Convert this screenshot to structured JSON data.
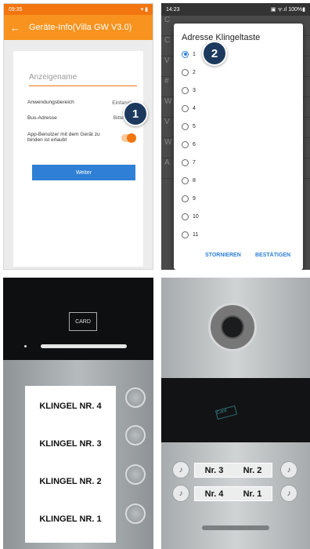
{
  "panel1": {
    "status_time": "09:35",
    "status_icons": "▾ ▮",
    "title": "Geräte-Info(Villa GW V3.0)",
    "back_icon": "←",
    "name_placeholder": "Anzeigename",
    "rows": [
      {
        "label": "Anwendungsbereich",
        "value": "Einfamilie ▾"
      },
      {
        "label": "Bus-Adresse",
        "value": "Bitte wähle"
      }
    ],
    "app_user_label": "App-Benutzer mit dem Gerät zu binden ist erlaubt",
    "toggle_on": true,
    "button_label": "Weiter",
    "badge": "1",
    "accent": "#f7931e"
  },
  "panel2": {
    "status_time": "14:23",
    "status_icons": "▣ ᯤ.ıl 100%▮",
    "bg_rows": [
      "C",
      "C",
      "V",
      "#",
      "W",
      "V",
      "W",
      "A"
    ],
    "dialog_title": "Adresse Klingeltaste",
    "options": [
      "1",
      "2",
      "3",
      "4",
      "5",
      "6",
      "7",
      "8",
      "9",
      "10",
      "11"
    ],
    "selected": "1",
    "cancel": "STORNIEREN",
    "confirm": "BESTÄTIGEN",
    "badge": "2",
    "accent": "#2e7fd5"
  },
  "panel3": {
    "card_label": "CARD",
    "bells": [
      "KLINGEL NR. 4",
      "KLINGEL NR. 3",
      "KLINGEL NR. 2",
      "KLINGEL NR. 1"
    ]
  },
  "panel4": {
    "reader_label": "Card",
    "plate1": [
      "Nr. 3",
      "Nr. 2"
    ],
    "plate2": [
      "Nr. 4",
      "Nr. 1"
    ],
    "bell_icon": "♪"
  }
}
